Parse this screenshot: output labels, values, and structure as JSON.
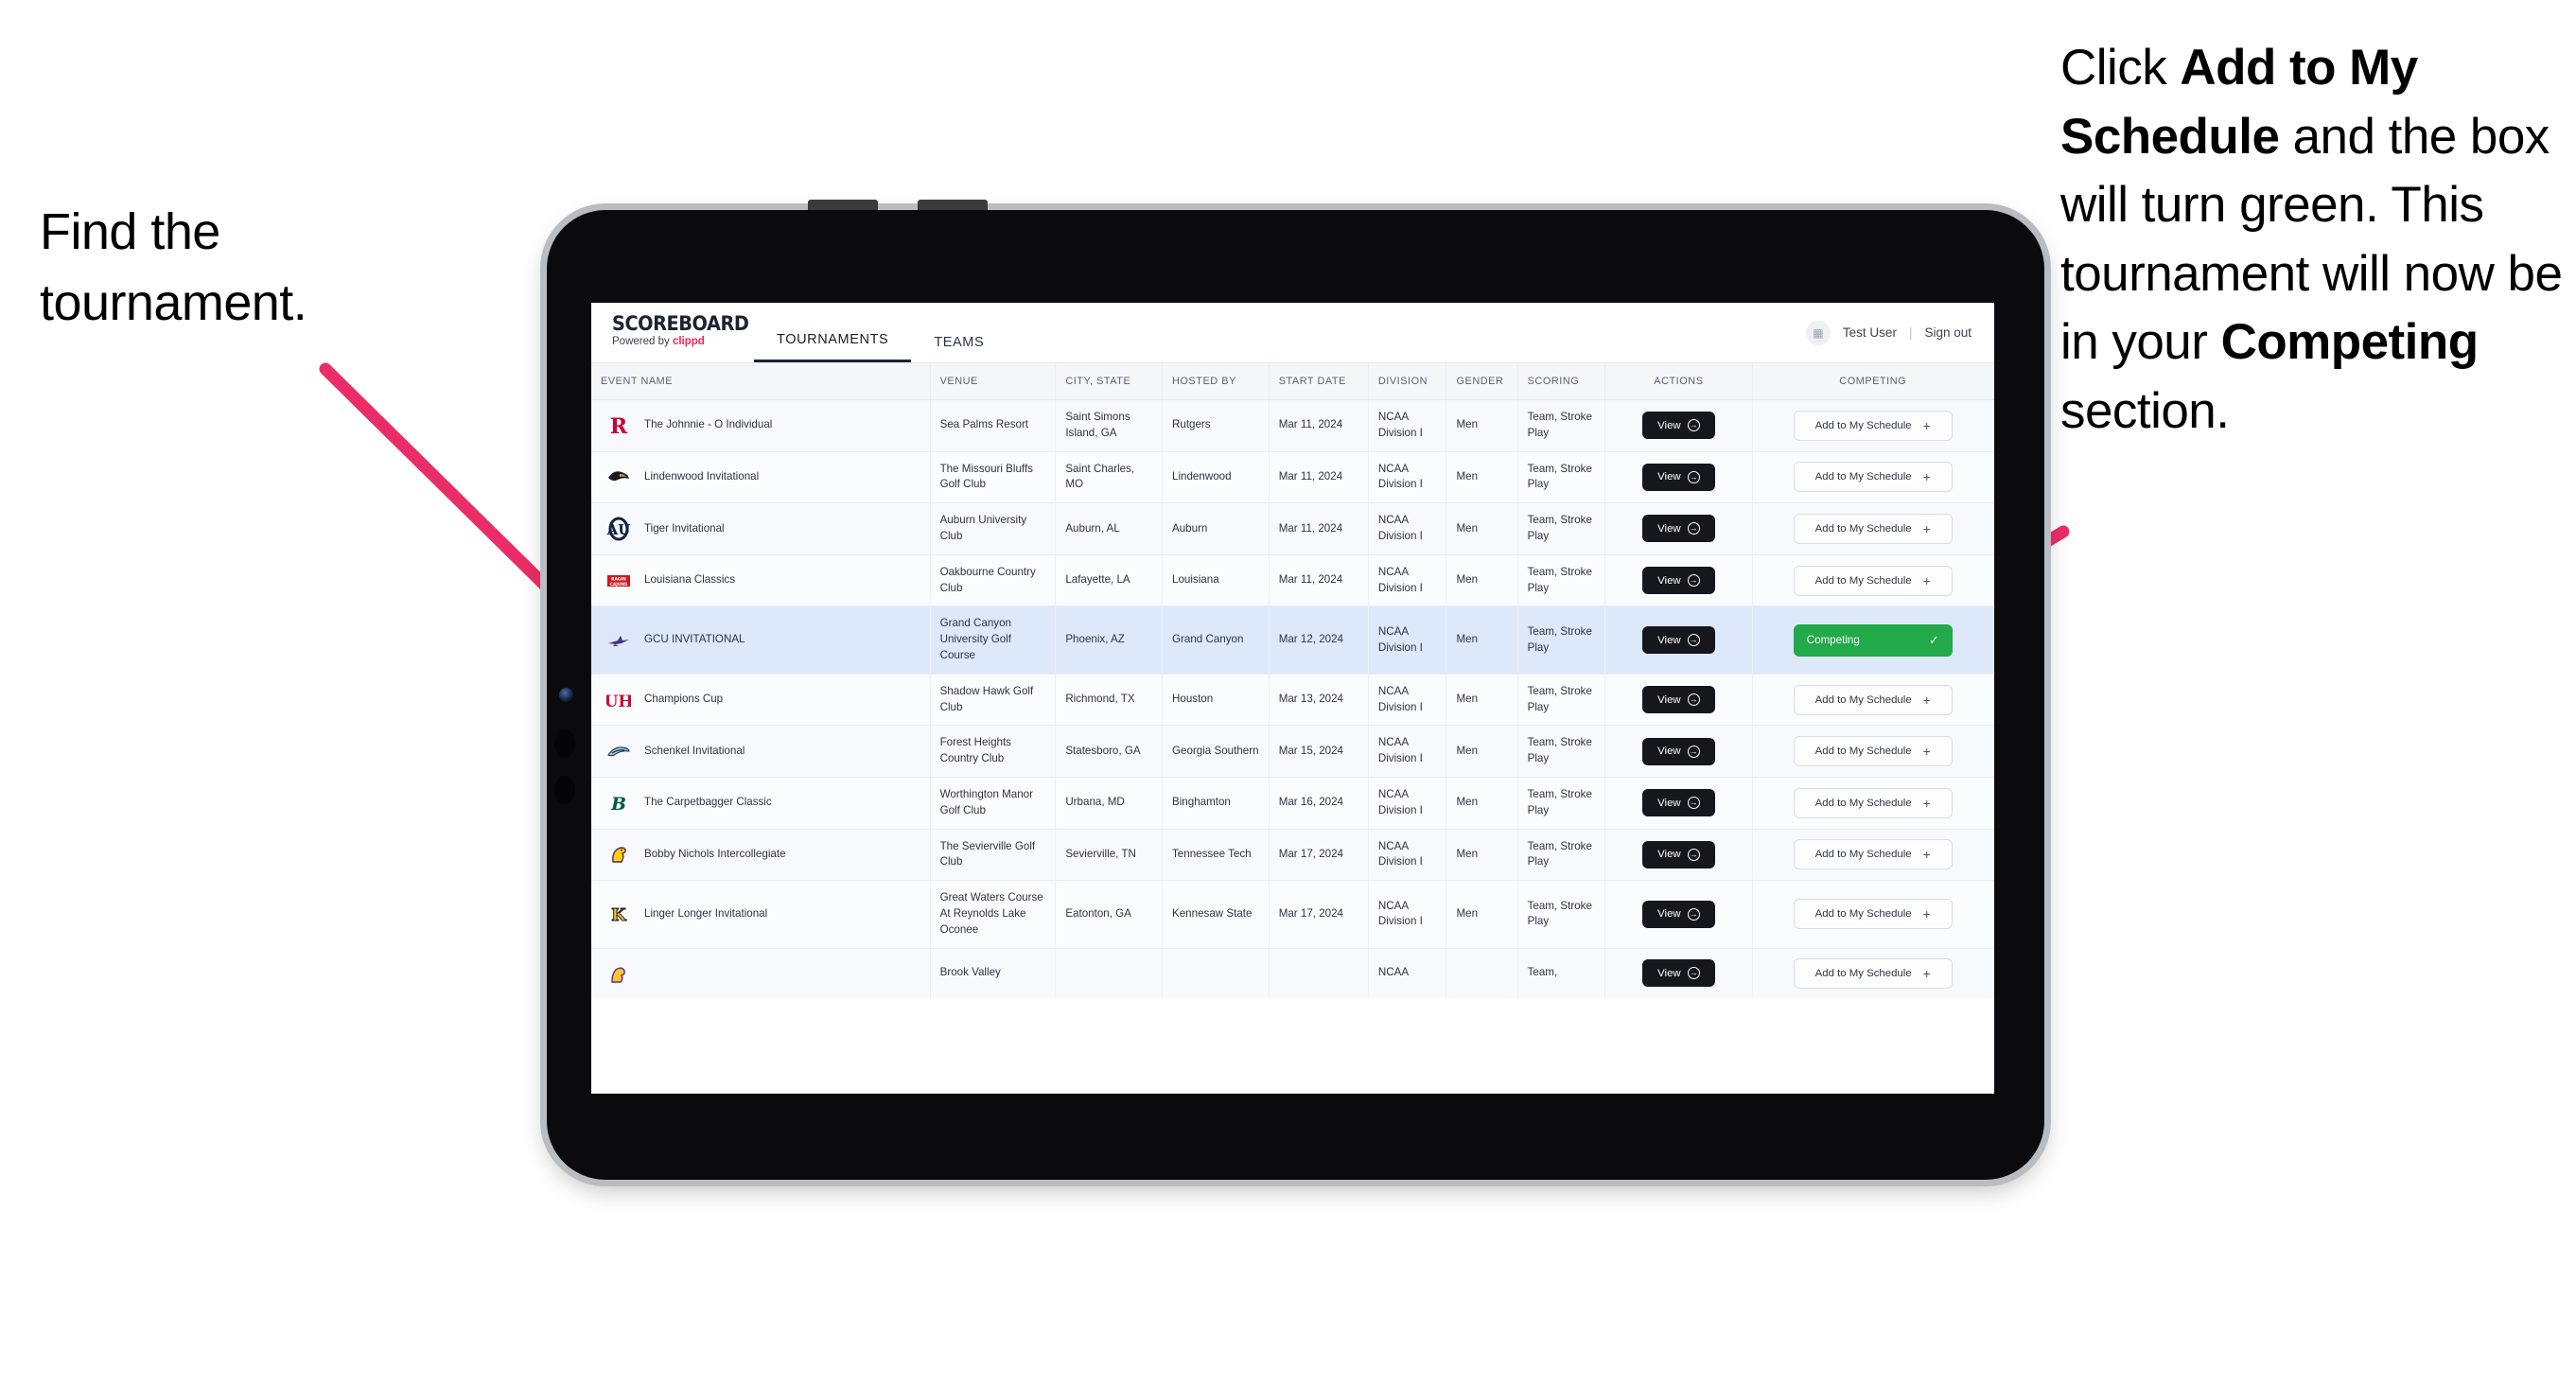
{
  "annotations": {
    "left": "Find the tournament.",
    "right_parts": [
      {
        "t": "Click ",
        "b": false
      },
      {
        "t": "Add to My Schedule",
        "b": true
      },
      {
        "t": " and the box will turn green. This tournament will now be in your ",
        "b": false
      },
      {
        "t": "Competing",
        "b": true
      },
      {
        "t": " section.",
        "b": false
      }
    ],
    "arrow_color": "#EA2D68"
  },
  "app": {
    "brand": {
      "name": "SCOREBOARD",
      "powered_prefix": "Powered by ",
      "powered_brand": "clippd"
    },
    "nav": [
      {
        "label": "TOURNAMENTS",
        "active": true
      },
      {
        "label": "TEAMS",
        "active": false
      }
    ],
    "user": {
      "avatar_icon": "user-badge-icon",
      "name": "Test User",
      "divider": "|",
      "signout": "Sign out"
    },
    "table": {
      "columns": [
        "EVENT NAME",
        "VENUE",
        "CITY, STATE",
        "HOSTED BY",
        "START DATE",
        "DIVISION",
        "GENDER",
        "SCORING",
        "ACTIONS",
        "COMPETING"
      ],
      "view_label": "View",
      "add_label": "Add to My Schedule",
      "add_plus": "+",
      "competing_label": "Competing",
      "competing_check": "✓",
      "view_arrow": "→",
      "rows": [
        {
          "logo": "rutgers-logo",
          "event": "The Johnnie - O Individual",
          "venue": "Sea Palms Resort",
          "city": "Saint Simons Island, GA",
          "host": "Rutgers",
          "date": "Mar 11, 2024",
          "division": "NCAA Division I",
          "gender": "Men",
          "scoring": "Team, Stroke Play",
          "competing": false
        },
        {
          "logo": "lindenwood-logo",
          "event": "Lindenwood Invitational",
          "venue": "The Missouri Bluffs Golf Club",
          "city": "Saint Charles, MO",
          "host": "Lindenwood",
          "date": "Mar 11, 2024",
          "division": "NCAA Division I",
          "gender": "Men",
          "scoring": "Team, Stroke Play",
          "competing": false
        },
        {
          "logo": "auburn-logo",
          "event": "Tiger Invitational",
          "venue": "Auburn University Club",
          "city": "Auburn, AL",
          "host": "Auburn",
          "date": "Mar 11, 2024",
          "division": "NCAA Division I",
          "gender": "Men",
          "scoring": "Team, Stroke Play",
          "competing": false
        },
        {
          "logo": "louisiana-logo",
          "event": "Louisiana Classics",
          "venue": "Oakbourne Country Club",
          "city": "Lafayette, LA",
          "host": "Louisiana",
          "date": "Mar 11, 2024",
          "division": "NCAA Division I",
          "gender": "Men",
          "scoring": "Team, Stroke Play",
          "competing": false
        },
        {
          "logo": "gcu-logo",
          "event": "GCU INVITATIONAL",
          "venue": "Grand Canyon University Golf Course",
          "city": "Phoenix, AZ",
          "host": "Grand Canyon",
          "date": "Mar 12, 2024",
          "division": "NCAA Division I",
          "gender": "Men",
          "scoring": "Team, Stroke Play",
          "competing": true
        },
        {
          "logo": "houston-logo",
          "event": "Champions Cup",
          "venue": "Shadow Hawk Golf Club",
          "city": "Richmond, TX",
          "host": "Houston",
          "date": "Mar 13, 2024",
          "division": "NCAA Division I",
          "gender": "Men",
          "scoring": "Team, Stroke Play",
          "competing": false
        },
        {
          "logo": "georgia-southern-logo",
          "event": "Schenkel Invitational",
          "venue": "Forest Heights Country Club",
          "city": "Statesboro, GA",
          "host": "Georgia Southern",
          "date": "Mar 15, 2024",
          "division": "NCAA Division I",
          "gender": "Men",
          "scoring": "Team, Stroke Play",
          "competing": false
        },
        {
          "logo": "binghamton-logo",
          "event": "The Carpetbagger Classic",
          "venue": "Worthington Manor Golf Club",
          "city": "Urbana, MD",
          "host": "Binghamton",
          "date": "Mar 16, 2024",
          "division": "NCAA Division I",
          "gender": "Men",
          "scoring": "Team, Stroke Play",
          "competing": false
        },
        {
          "logo": "tennessee-tech-logo",
          "event": "Bobby Nichols Intercollegiate",
          "venue": "The Sevierville Golf Club",
          "city": "Sevierville, TN",
          "host": "Tennessee Tech",
          "date": "Mar 17, 2024",
          "division": "NCAA Division I",
          "gender": "Men",
          "scoring": "Team, Stroke Play",
          "competing": false
        },
        {
          "logo": "kennesaw-state-logo",
          "event": "Linger Longer Invitational",
          "venue": "Great Waters Course At Reynolds Lake Oconee",
          "city": "Eatonton, GA",
          "host": "Kennesaw State",
          "date": "Mar 17, 2024",
          "division": "NCAA Division I",
          "gender": "Men",
          "scoring": "Team, Stroke Play",
          "competing": false
        },
        {
          "logo": "ecu-logo",
          "event": "",
          "venue": "Brook Valley",
          "city": "",
          "host": "",
          "date": "",
          "division": "NCAA",
          "gender": "",
          "scoring": "Team,",
          "competing": false
        }
      ]
    }
  }
}
